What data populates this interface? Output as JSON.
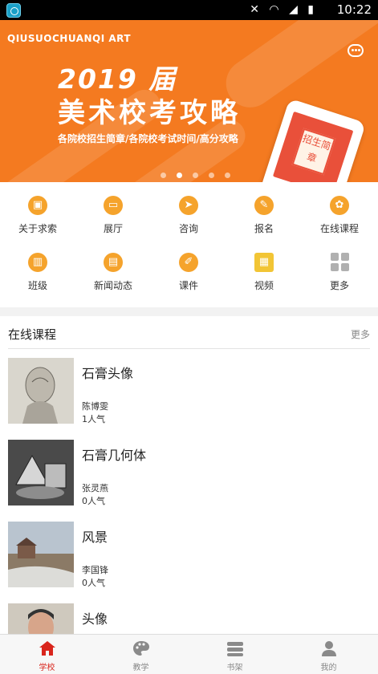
{
  "status_bar": {
    "time": "10:22",
    "icons": "✕ ◠ ◢ ▮"
  },
  "banner": {
    "brand": "QIUSUOCHUANQI ART",
    "title_line1": "2019 届",
    "title_line2": "美术校考攻略",
    "subtitle": "各院校招生简章/各院校考试时间/高分攻略",
    "phone_sign": "招生简章",
    "dots": 5,
    "active_dot": 1
  },
  "menu": {
    "items": [
      {
        "label": "关于求索",
        "icon": "about-icon"
      },
      {
        "label": "展厅",
        "icon": "gallery-icon"
      },
      {
        "label": "咨询",
        "icon": "consult-icon"
      },
      {
        "label": "报名",
        "icon": "signup-icon"
      },
      {
        "label": "在线课程",
        "icon": "online-course-icon"
      },
      {
        "label": "班级",
        "icon": "class-icon"
      },
      {
        "label": "新闻动态",
        "icon": "news-icon"
      },
      {
        "label": "课件",
        "icon": "courseware-icon"
      },
      {
        "label": "视频",
        "icon": "video-icon"
      },
      {
        "label": "更多",
        "icon": "more-grid-icon"
      }
    ]
  },
  "courses": {
    "title": "在线课程",
    "more": "更多",
    "items": [
      {
        "name": "石膏头像",
        "teacher": "陈博雯",
        "popularity": "1人气"
      },
      {
        "name": "石膏几何体",
        "teacher": "张灵燕",
        "popularity": "0人气"
      },
      {
        "name": "风景",
        "teacher": "李国锋",
        "popularity": "0人气"
      },
      {
        "name": "头像"
      }
    ]
  },
  "tabbar": {
    "tabs": [
      {
        "label": "学校",
        "active": true
      },
      {
        "label": "教学"
      },
      {
        "label": "书架"
      },
      {
        "label": "我的"
      }
    ]
  },
  "colors": {
    "accent": "#f47a20",
    "tab_active": "#d9251c"
  }
}
